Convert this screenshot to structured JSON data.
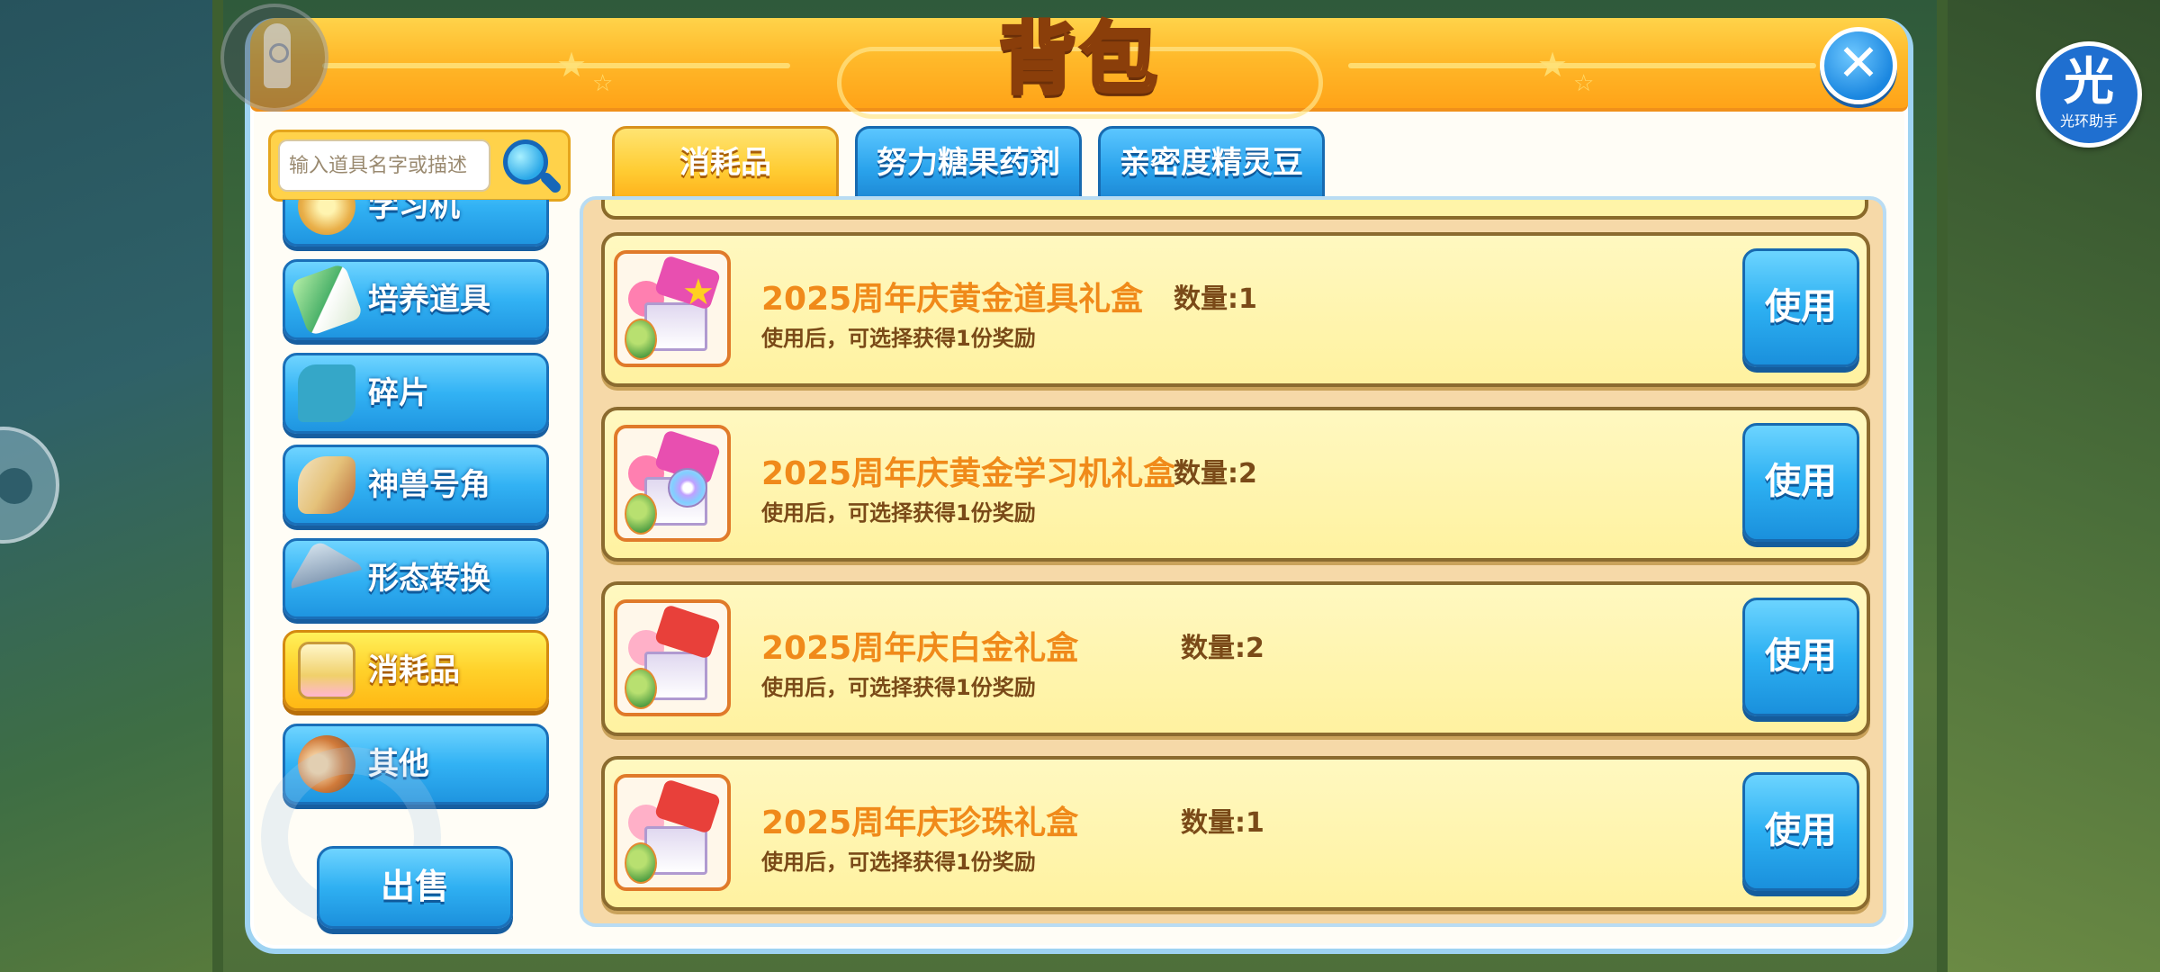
{
  "window": {
    "title": "背包",
    "close_symbol": "✕"
  },
  "helper": {
    "glyph": "光",
    "label": "光环助手"
  },
  "search": {
    "placeholder": "输入道具名字或描述"
  },
  "categories": [
    {
      "label": "学习机",
      "icon": "learning-machine-icon"
    },
    {
      "label": "培养道具",
      "icon": "training-item-icon"
    },
    {
      "label": "碎片",
      "icon": "fragment-icon"
    },
    {
      "label": "神兽号角",
      "icon": "beast-horn-icon"
    },
    {
      "label": "形态转换",
      "icon": "form-change-icon"
    },
    {
      "label": "消耗品",
      "icon": "consumable-icon",
      "active": true
    },
    {
      "label": "其他",
      "icon": "other-icon"
    }
  ],
  "sell_label": "出售",
  "tabs": [
    {
      "label": "消耗品",
      "active": true
    },
    {
      "label": "努力糖果药剂",
      "active": false
    },
    {
      "label": "亲密度精灵豆",
      "active": false
    }
  ],
  "items": [
    {
      "name": "2025周年庆黄金道具礼盒",
      "qty": "数量:1",
      "desc": "使用后，可选择获得1份奖励",
      "use_label": "使用"
    },
    {
      "name": "2025周年庆黄金学习机礼盒",
      "qty": "数量:2",
      "desc": "使用后，可选择获得1份奖励",
      "use_label": "使用"
    },
    {
      "name": "2025周年庆白金礼盒",
      "qty": "数量:2",
      "desc": "使用后，可选择获得1份奖励",
      "use_label": "使用"
    },
    {
      "name": "2025周年庆珍珠礼盒",
      "qty": "数量:1",
      "desc": "使用后，可选择获得1份奖励",
      "use_label": "使用"
    }
  ],
  "colors": {
    "header_orange": "#ffb92a",
    "button_blue": "#2db0f2",
    "active_yellow": "#ffd12a",
    "item_name_orange": "#f08a1a"
  }
}
